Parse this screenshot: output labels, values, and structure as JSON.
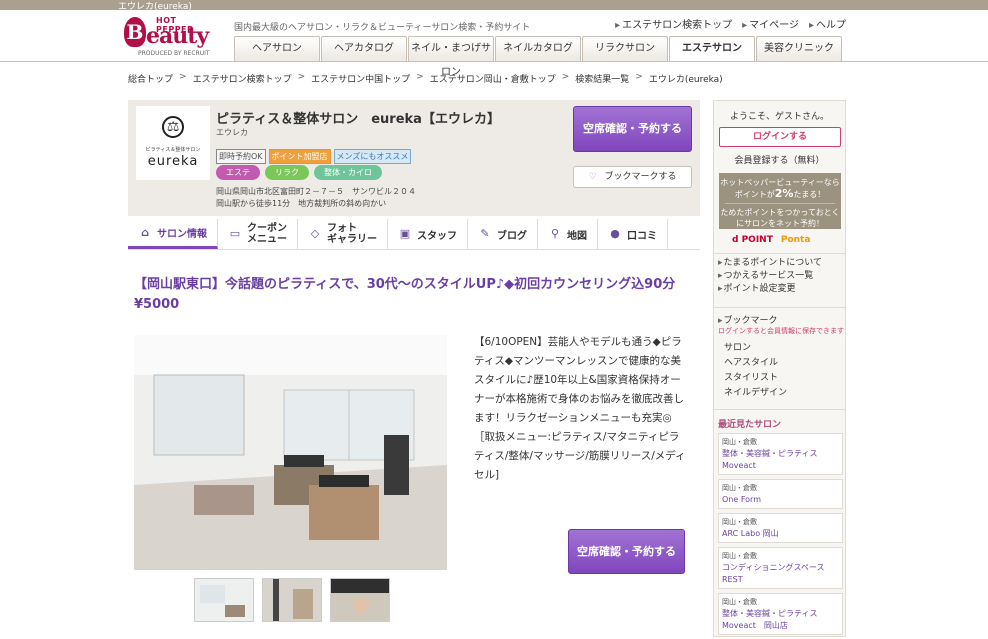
{
  "window_title": "エウレカ(eureka)",
  "header": {
    "logo_top": "HOT PEPPER",
    "logo_b": "B",
    "logo_main": "eauty",
    "logo_produced": "PRODUCED BY RECRUIT",
    "tagline": "国内最大級のヘアサロン・リラク＆ビューティーサロン検索・予約サイト",
    "links": [
      "エステサロン検索トップ",
      "マイページ",
      "ヘルプ"
    ],
    "tabs": [
      "ヘアサロン",
      "ヘアカタログ",
      "ネイル・まつげサロン",
      "ネイルカタログ",
      "リラクサロン",
      "エステサロン",
      "美容クリニック"
    ],
    "active_tab": "エステサロン"
  },
  "breadcrumb": [
    "総合トップ",
    "エステサロン検索トップ",
    "エステサロン中国トップ",
    "エステサロン岡山・倉敷トップ",
    "検索結果一覧",
    "エウレカ(eureka)"
  ],
  "breadcrumb_sep": ">",
  "salon": {
    "logo_symbol": "⚖",
    "logo_sub": "ピラティス＆整体サロン",
    "logo_name": "eureka",
    "name": "ピラティス＆整体サロン　eureka【エウレカ】",
    "kana": "エウレカ",
    "tags": [
      "即時予約OK",
      "ポイント加盟店",
      "メンズにもオススメ"
    ],
    "categories": [
      "エステ",
      "リラク",
      "整体・カイロ"
    ],
    "address_line1": "岡山県岡山市北区富田町２－７－５　サンワビル２０４",
    "address_line2": "岡山駅から徒歩11分　地方裁判所の斜め向かい",
    "reserve_button": "空席確認・予約する",
    "bookmark_button": "ブックマークする"
  },
  "subnav": [
    {
      "label": "サロン情報",
      "icon": "home-icon"
    },
    {
      "label": "クーポン\nメニュー",
      "icon": "coupon-icon"
    },
    {
      "label": "フォト\nギャラリー",
      "icon": "photo-icon"
    },
    {
      "label": "スタッフ",
      "icon": "staff-icon"
    },
    {
      "label": "ブログ",
      "icon": "pencil-icon"
    },
    {
      "label": "地図",
      "icon": "map-pin-icon"
    },
    {
      "label": "口コミ",
      "icon": "comment-icon"
    }
  ],
  "main": {
    "headline": "【岡山駅東口】今話題のピラティスで、30代～のスタイルUP♪◆初回カウンセリング込90分¥5000",
    "description": "【6/10OPEN】芸能人やモデルも通う◆ピラティス◆マンツーマンレッスンで健康的な美スタイルに♪歴10年以上&国家資格保持オーナーが本格施術で身体のお悩みを徹底改善します！リラクゼーションメニューも充実◎［取扱メニュー:ピラティス/マタニティピラティス/整体/マッサージ/筋膜リリース/メディセル]",
    "reserve_button": "空席確認・予約する"
  },
  "sidebar": {
    "welcome": "ようこそ、ゲストさん。",
    "login_button": "ログインする",
    "register_link": "会員登録する（無料）",
    "point_line1": "ホットペッパービューティーなら",
    "point_line2a": "ポイントが",
    "point_pct": "2%",
    "point_line2b": "たまる！",
    "point_line3": "ためたポイントをつかっておとくにサロンをネット予約！",
    "logo_d": "d POINT",
    "logo_ponta": "Ponta",
    "links": [
      "たまるポイントについて",
      "つかえるサービス一覧",
      "ポイント設定変更"
    ],
    "bookmark_title": "ブックマーク",
    "bookmark_note": "ログインすると会員情報に保存できます",
    "bookmark_links": [
      "サロン",
      "ヘアスタイル",
      "スタイリスト",
      "ネイルデザイン"
    ],
    "recent_title": "最近見たサロン",
    "recent": [
      {
        "area": "岡山・倉敷",
        "name": "整体・美容鍼・ピラティス\nMoveact"
      },
      {
        "area": "岡山・倉敷",
        "name": "One Form"
      },
      {
        "area": "岡山・倉敷",
        "name": "ARC Labo 岡山"
      },
      {
        "area": "岡山・倉敷",
        "name": "コンディショニングスペース\nREST"
      },
      {
        "area": "岡山・倉敷",
        "name": "整体・美容鍼・ピラティス\nMoveact　岡山店"
      }
    ]
  }
}
